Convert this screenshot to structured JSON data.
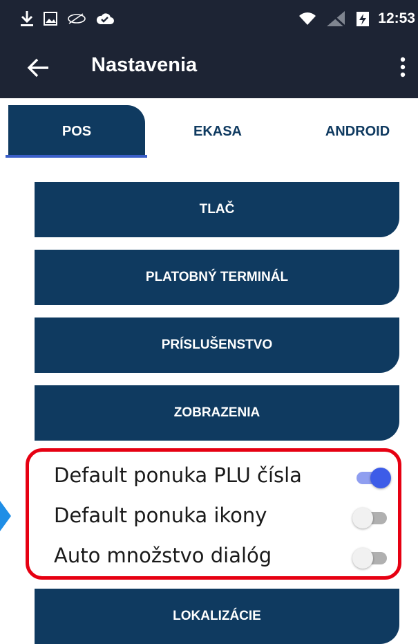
{
  "status_bar": {
    "time": "12:53",
    "icons_left": [
      "download-icon",
      "image-icon",
      "cast-icon",
      "cloud-check-icon"
    ],
    "icons_right": [
      "wifi-icon",
      "no-signal-icon",
      "battery-charging-icon"
    ]
  },
  "toolbar": {
    "title": "Nastavenia",
    "back_icon": "arrow-back-icon",
    "more_icon": "more-vert-icon"
  },
  "tabs": [
    {
      "label": "POS",
      "active": true
    },
    {
      "label": "EKASA",
      "active": false
    },
    {
      "label": "ANDROID",
      "active": false
    }
  ],
  "menu": {
    "print": "TLAČ",
    "payment_terminal": "PLATOBNÝ TERMINÁL",
    "accessories": "PRÍSLUŠENSTVO",
    "display": "ZOBRAZENIA",
    "localization": "LOKALIZÁCIE"
  },
  "toggles": [
    {
      "label": "Default ponuka PLU čísla",
      "on": true
    },
    {
      "label": "Default ponuka ikony",
      "on": false
    },
    {
      "label": "Auto množstvo dialóg",
      "on": false
    }
  ],
  "colors": {
    "bar": "#1d2434",
    "primary": "#0f3a60",
    "toggle_on": "#3d5ce8",
    "highlight": "#e60012",
    "pointer": "#1f8ee6"
  }
}
